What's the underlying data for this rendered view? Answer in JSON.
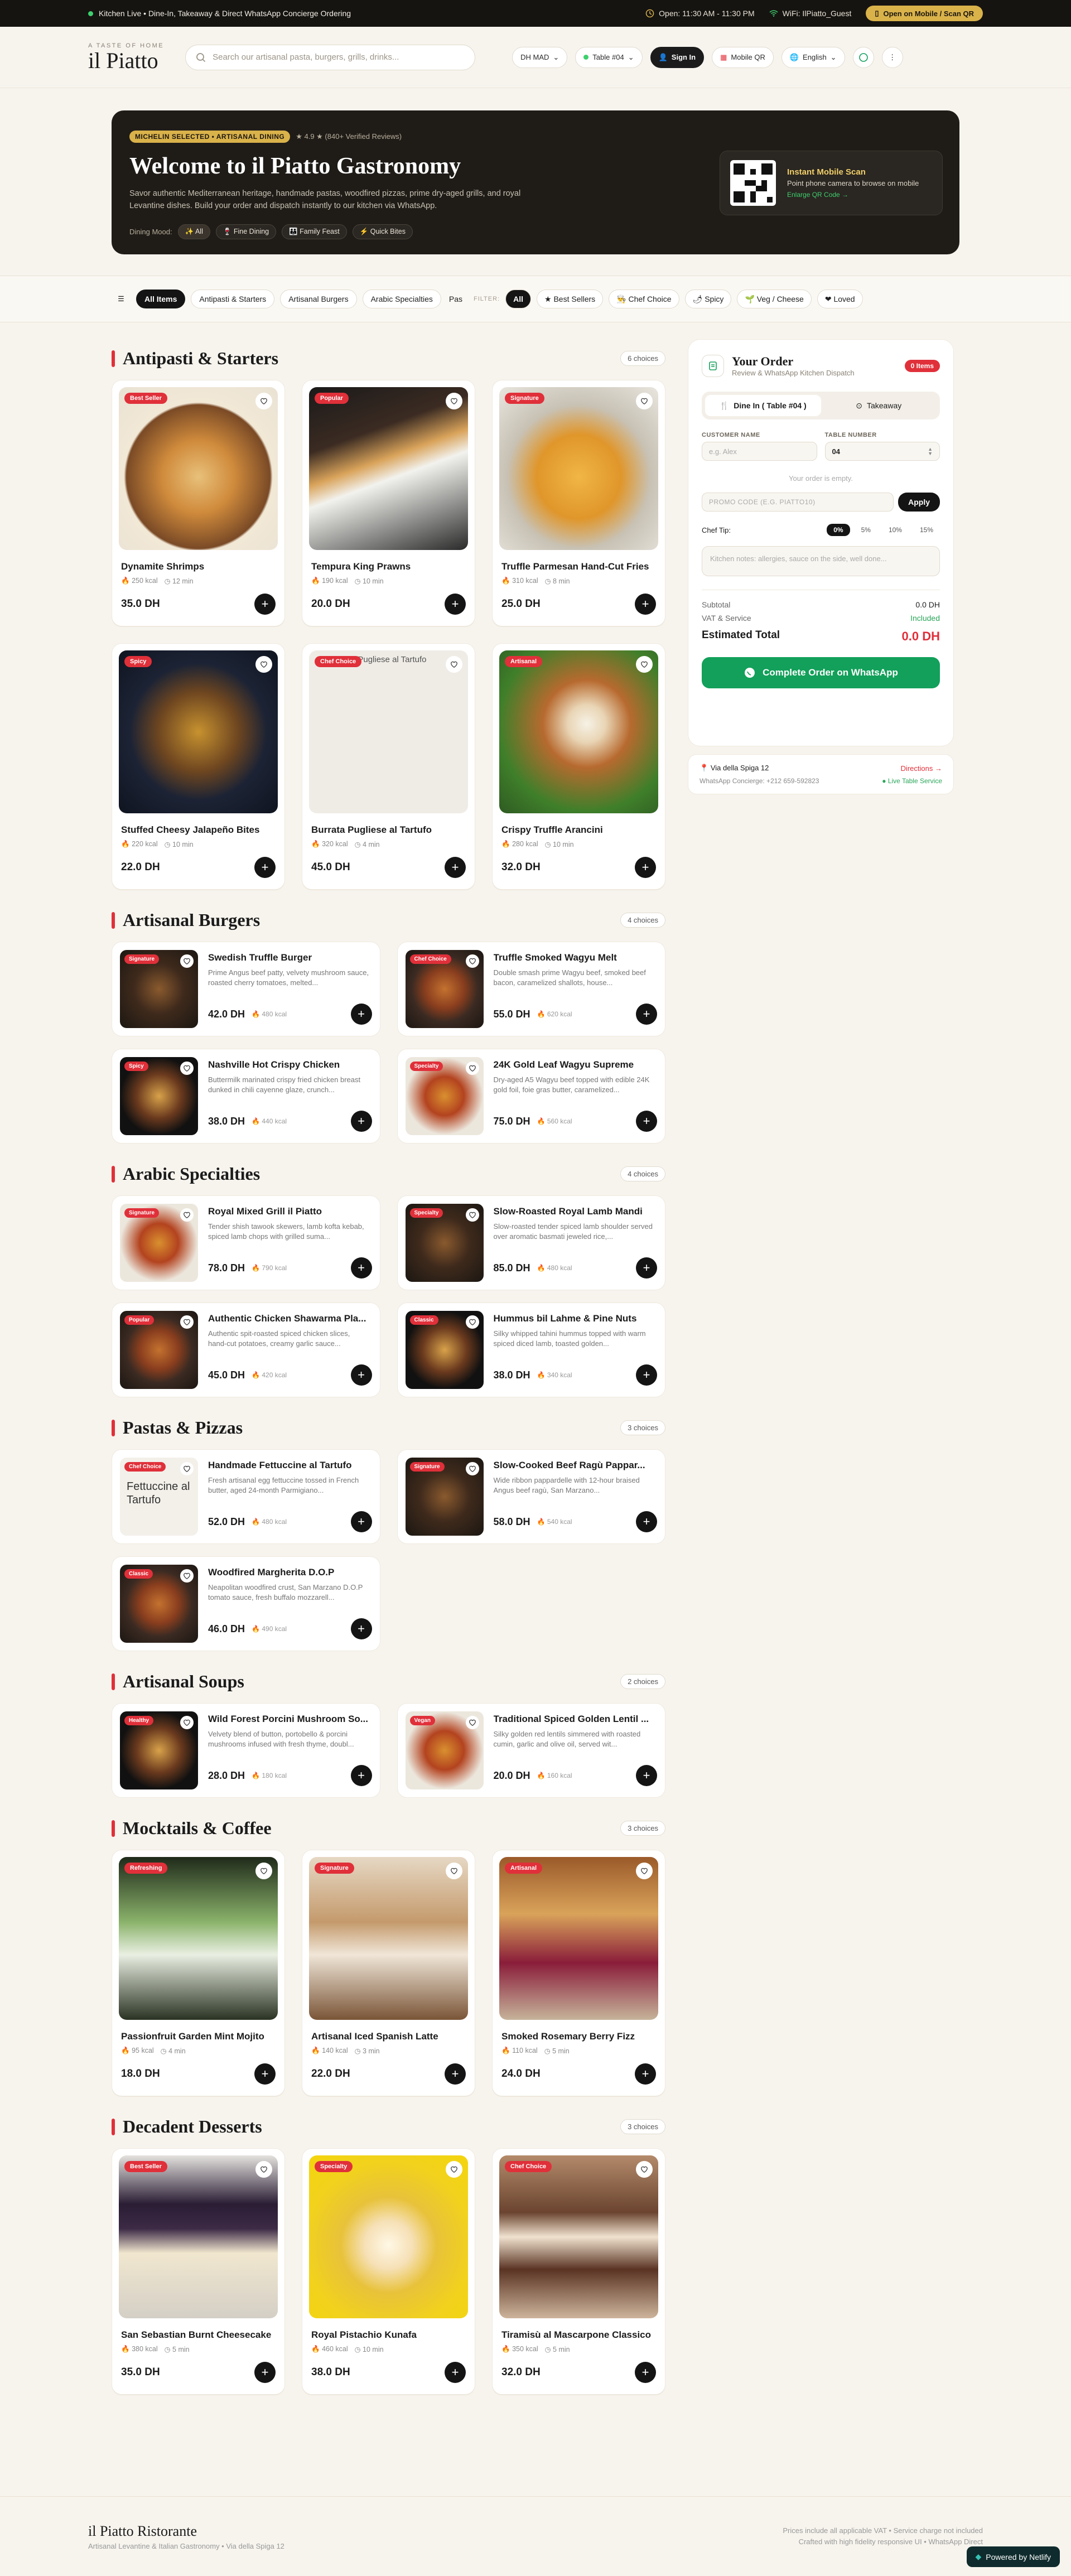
{
  "topbar": {
    "status": "Kitchen Live • Dine-In, Takeaway & Direct WhatsApp Concierge Ordering",
    "hours": "Open: 11:30 AM - 11:30 PM",
    "wifi": "WiFi: IlPiatto_Guest",
    "qr_label": "Open on Mobile / Scan QR"
  },
  "header": {
    "brand_small": "A TASTE OF HOME",
    "brand": "il Piatto",
    "search_placeholder": "Search our artisanal pasta, burgers, grills, drinks...",
    "currency": "DH MAD",
    "table": "Table #04",
    "signin": "Sign In",
    "mobileqr": "Mobile QR",
    "language": "English"
  },
  "hero": {
    "badge": "MICHELIN SELECTED • ARTISANAL DINING",
    "rating": "★ 4.9 ★ (840+ Verified Reviews)",
    "title": "Welcome to il Piatto Gastronomy",
    "subtitle": "Savor authentic Mediterranean heritage, handmade pastas, woodfired pizzas, prime dry-aged grills, and royal Levantine dishes. Build your order and dispatch instantly to our kitchen via WhatsApp.",
    "mood_label": "Dining Mood:",
    "moods": [
      "✨ All",
      "🍷 Fine Dining",
      "👪 Family Feast",
      "⚡ Quick Bites"
    ],
    "qr_title": "Instant Mobile Scan",
    "qr_sub": "Point phone camera to browse on mobile",
    "qr_link": "Enlarge QR Code →"
  },
  "categories": [
    "All Items",
    "Antipasti & Starters",
    "Artisanal Burgers",
    "Arabic Specialties",
    "Pas"
  ],
  "filters": {
    "label": "FILTER:",
    "chips": [
      "All",
      "★ Best Sellers",
      "👨‍🍳 Chef Choice",
      "🌶 Spicy",
      "🌱 Veg / Cheese",
      "❤ Loved"
    ]
  },
  "sections": {
    "antipasti": {
      "title": "Antipasti & Starters",
      "count": "6 choices",
      "items": [
        {
          "name": "Dynamite Shrimps",
          "kcal": "250 kcal",
          "time": "12 min",
          "price": "35.0 DH",
          "tag": "Best Seller"
        },
        {
          "name": "Tempura King Prawns",
          "kcal": "190 kcal",
          "time": "10 min",
          "price": "20.0 DH",
          "tag": "Popular"
        },
        {
          "name": "Truffle Parmesan Hand-Cut Fries",
          "kcal": "310 kcal",
          "time": "8 min",
          "price": "25.0 DH",
          "tag": "Signature"
        },
        {
          "name": "Stuffed Cheesy Jalapeño Bites",
          "kcal": "220 kcal",
          "time": "10 min",
          "price": "22.0 DH",
          "tag": "Spicy"
        },
        {
          "name": "Burrata Pugliese al Tartufo",
          "kcal": "320 kcal",
          "time": "4 min",
          "price": "45.0 DH",
          "tag": "Chef Choice",
          "alt": "Burrata Pugliese al Tartufo"
        },
        {
          "name": "Crispy Truffle Arancini",
          "kcal": "280 kcal",
          "time": "10 min",
          "price": "32.0 DH",
          "tag": "Artisanal"
        }
      ]
    },
    "burgers": {
      "title": "Artisanal Burgers",
      "count": "4 choices",
      "items": [
        {
          "name": "Swedish Truffle Burger",
          "desc": "Prime Angus beef patty, velvety mushroom sauce, roasted cherry tomatoes, melted...",
          "price": "42.0 DH",
          "kcal": "480 kcal",
          "tag": "Signature"
        },
        {
          "name": "Truffle Smoked Wagyu Melt",
          "desc": "Double smash prime Wagyu beef, smoked beef bacon, caramelized shallots, house...",
          "price": "55.0 DH",
          "kcal": "620 kcal",
          "tag": "Chef Choice"
        },
        {
          "name": "Nashville Hot Crispy Chicken",
          "desc": "Buttermilk marinated crispy fried chicken breast dunked in chili cayenne glaze, crunch...",
          "price": "38.0 DH",
          "kcal": "440 kcal",
          "tag": "Spicy"
        },
        {
          "name": "24K Gold Leaf Wagyu Supreme",
          "desc": "Dry-aged A5 Wagyu beef topped with edible 24K gold foil, foie gras butter, caramelized...",
          "price": "75.0 DH",
          "kcal": "560 kcal",
          "tag": "Specialty"
        }
      ]
    },
    "arabic": {
      "title": "Arabic Specialties",
      "count": "4 choices",
      "items": [
        {
          "name": "Royal Mixed Grill il Piatto",
          "desc": "Tender shish tawook skewers, lamb kofta kebab, spiced lamb chops with grilled suma...",
          "price": "78.0 DH",
          "kcal": "790 kcal",
          "tag": "Signature"
        },
        {
          "name": "Slow-Roasted Royal Lamb Mandi",
          "desc": "Slow-roasted tender spiced lamb shoulder served over aromatic basmati jeweled rice,...",
          "price": "85.0 DH",
          "kcal": "480 kcal",
          "tag": "Specialty"
        },
        {
          "name": "Authentic Chicken Shawarma Pla...",
          "desc": "Authentic spit-roasted spiced chicken slices, hand-cut potatoes, creamy garlic sauce...",
          "price": "45.0 DH",
          "kcal": "420 kcal",
          "tag": "Popular"
        },
        {
          "name": "Hummus bil Lahme & Pine Nuts",
          "desc": "Silky whipped tahini hummus topped with warm spiced diced lamb, toasted golden...",
          "price": "38.0 DH",
          "kcal": "340 kcal",
          "tag": "Classic"
        }
      ]
    },
    "pastas": {
      "title": "Pastas & Pizzas",
      "count": "3 choices",
      "items": [
        {
          "name": "Handmade Fettuccine al Tartufo",
          "desc": "Fresh artisanal egg fettuccine tossed in French butter, aged 24-month Parmigiano...",
          "price": "52.0 DH",
          "kcal": "480 kcal",
          "tag": "Chef Choice",
          "alt": "Fettuccine al Tartufo"
        },
        {
          "name": "Slow-Cooked Beef Ragù Pappar...",
          "desc": "Wide ribbon pappardelle with 12-hour braised Angus beef ragù, San Marzano...",
          "price": "58.0 DH",
          "kcal": "540 kcal",
          "tag": "Signature"
        },
        {
          "name": "Woodfired Margherita D.O.P",
          "desc": "Neapolitan woodfired crust, San Marzano D.O.P tomato sauce, fresh buffalo mozzarell...",
          "price": "46.0 DH",
          "kcal": "490 kcal",
          "tag": "Classic"
        }
      ]
    },
    "soups": {
      "title": "Artisanal Soups",
      "count": "2 choices",
      "items": [
        {
          "name": "Wild Forest Porcini Mushroom So...",
          "desc": "Velvety blend of button, portobello & porcini mushrooms infused with fresh thyme, doubl...",
          "price": "28.0 DH",
          "kcal": "180 kcal",
          "tag": "Healthy"
        },
        {
          "name": "Traditional Spiced Golden Lentil ...",
          "desc": "Silky golden red lentils simmered with roasted cumin, garlic and olive oil, served wit...",
          "price": "20.0 DH",
          "kcal": "160 kcal",
          "tag": "Vegan"
        }
      ]
    },
    "drinks": {
      "title": "Mocktails & Coffee",
      "count": "3 choices",
      "items": [
        {
          "name": "Passionfruit Garden Mint Mojito",
          "kcal": "95 kcal",
          "time": "4 min",
          "price": "18.0 DH",
          "tag": "Refreshing"
        },
        {
          "name": "Artisanal Iced Spanish Latte",
          "kcal": "140 kcal",
          "time": "3 min",
          "price": "22.0 DH",
          "tag": "Signature"
        },
        {
          "name": "Smoked Rosemary Berry Fizz",
          "kcal": "110 kcal",
          "time": "5 min",
          "price": "24.0 DH",
          "tag": "Artisanal"
        }
      ]
    },
    "desserts": {
      "title": "Decadent Desserts",
      "count": "3 choices",
      "items": [
        {
          "name": "San Sebastian Burnt Cheesecake",
          "kcal": "380 kcal",
          "time": "5 min",
          "price": "35.0 DH",
          "tag": "Best Seller"
        },
        {
          "name": "Royal Pistachio Kunafa",
          "kcal": "460 kcal",
          "time": "10 min",
          "price": "38.0 DH",
          "tag": "Specialty"
        },
        {
          "name": "Tiramisù al Mascarpone Classico",
          "kcal": "350 kcal",
          "time": "5 min",
          "price": "32.0 DH",
          "tag": "Chef Choice"
        }
      ]
    }
  },
  "order": {
    "title": "Your Order",
    "subtitle": "Review & WhatsApp Kitchen Dispatch",
    "items_badge": "0 Items",
    "tab_dinein": "Dine In ( Table #04 )",
    "tab_takeaway": "Takeaway",
    "name_label": "CUSTOMER NAME",
    "name_placeholder": "e.g. Alex",
    "table_label": "TABLE NUMBER",
    "table_value": "04",
    "empty": "Your order is empty.",
    "promo_placeholder": "PROMO CODE (E.G. PIATTO10)",
    "apply": "Apply",
    "tip_label": "Chef Tip:",
    "tips": [
      "0%",
      "5%",
      "10%",
      "15%"
    ],
    "notes_placeholder": "Kitchen notes: allergies, sauce on the side, well done...",
    "subtotal_label": "Subtotal",
    "subtotal": "0.0 DH",
    "vat_label": "VAT & Service",
    "vat": "Included",
    "total_label": "Estimated Total",
    "total": "0.0 DH",
    "cta": "Complete Order on WhatsApp"
  },
  "location": {
    "address": "Via della Spiga 12",
    "directions": "Directions →",
    "concierge": "WhatsApp Concierge: +212 659-592823",
    "live": "● Live Table Service"
  },
  "footer": {
    "brand": "il Piatto Ristorante",
    "sub": "Artisanal Levantine & Italian Gastronomy • Via della Spiga 12",
    "r1": "Prices include all applicable VAT • Service charge not included",
    "r2": "Crafted with high fidelity responsive UI • WhatsApp Direct",
    "netlify": "Powered by Netlify"
  },
  "colors": {
    "accent": "#e0303a",
    "gold": "#d9b24a",
    "whatsapp": "#12a05a",
    "dark": "#1f1c18"
  }
}
